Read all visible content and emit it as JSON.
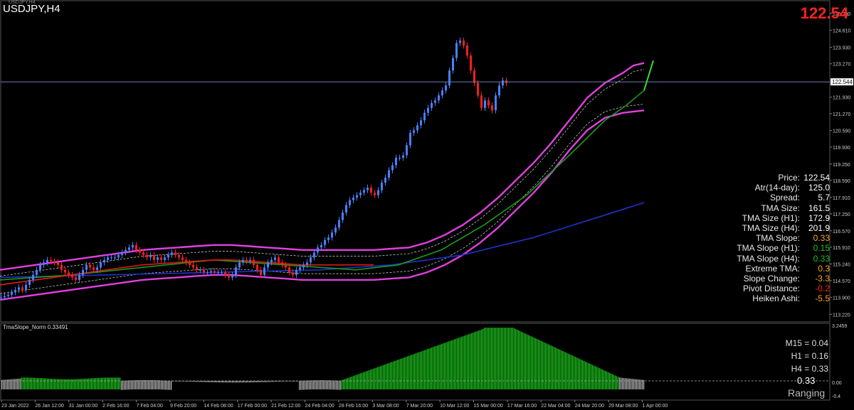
{
  "header": {
    "symbol_title": "USDJPY,H4",
    "tiny_label": "USDJPY,H4",
    "current_price": "122.54"
  },
  "chart_data": {
    "type": "line",
    "title": "USDJPY,H4",
    "price_axis_labels": [
      "125.290",
      "124.610",
      "123.930",
      "123.270",
      "122.544",
      "121.930",
      "121.270",
      "120.590",
      "119.930",
      "119.250",
      "118.590",
      "117.910",
      "117.250",
      "116.570",
      "115.910",
      "115.240",
      "114.570",
      "113.900",
      "113.220"
    ],
    "price_ticks": [
      125.29,
      124.61,
      123.93,
      123.27,
      122.544,
      121.93,
      121.27,
      120.59,
      119.93,
      119.25,
      118.59,
      117.91,
      117.25,
      116.57,
      115.91,
      115.24,
      114.57,
      113.9,
      113.22
    ],
    "current_price_line": 122.544,
    "ylim": [
      113.0,
      125.6
    ],
    "time_axis_labels": [
      "23 Jan 2022",
      "26 Jan 12:00",
      "31 Jan 00:00",
      "2 Feb 16:00",
      "7 Feb 04:00",
      "9 Feb 20:00",
      "14 Feb 08:00",
      "17 Feb 00:00",
      "21 Feb 12:00",
      "24 Feb 04:00",
      "28 Feb 16:00",
      "3 Mar 08:00",
      "7 Mar 20:00",
      "10 Mar 12:00",
      "15 Mar 00:00",
      "17 Mar 16:00",
      "22 Mar 04:00",
      "24 Mar 20:00",
      "29 Mar 08:00",
      "1 Apr 00:00"
    ],
    "price_path_x": [
      0,
      5,
      10,
      15,
      20,
      25,
      30,
      35,
      40,
      45,
      50,
      55,
      60,
      65,
      70,
      75,
      80,
      85,
      90,
      95,
      100,
      105,
      110,
      115,
      120,
      125,
      130,
      135,
      140,
      145,
      150,
      155,
      160,
      165,
      170,
      175,
      180,
      185,
      190,
      195,
      200,
      205,
      210,
      215,
      220,
      225,
      230,
      235,
      240,
      245,
      250,
      255,
      260,
      265,
      270,
      275,
      280,
      285,
      290,
      295,
      300,
      305,
      310,
      315,
      320,
      325,
      330,
      335,
      340,
      345,
      350,
      355,
      360,
      365,
      370,
      375,
      380,
      385,
      390,
      395,
      400,
      405,
      410,
      415,
      420,
      425,
      430,
      435,
      440,
      445,
      450,
      455,
      460,
      465,
      470,
      475,
      480,
      485,
      490,
      495,
      500,
      505,
      510,
      515,
      520,
      525,
      530,
      535,
      540,
      545,
      550,
      555,
      560,
      565,
      570,
      575,
      580,
      585,
      590,
      595,
      600,
      605,
      610,
      615,
      620,
      625,
      630,
      635,
      640,
      645,
      650,
      655,
      660,
      665,
      670,
      675,
      680,
      685,
      690,
      695,
      700,
      705,
      710,
      715,
      720,
      725,
      730,
      735,
      740,
      745,
      750,
      755,
      760,
      765,
      770,
      775,
      780,
      785,
      790,
      795,
      800,
      805,
      810,
      815,
      820,
      825,
      830,
      835,
      840,
      845,
      850,
      855,
      860,
      865,
      870,
      875,
      880,
      885,
      890,
      895,
      900
    ],
    "price_path": [
      113.9,
      113.95,
      114.0,
      114.1,
      114.2,
      114.3,
      114.2,
      114.4,
      114.6,
      114.8,
      115.0,
      115.2,
      115.3,
      115.4,
      115.35,
      115.3,
      115.2,
      115.0,
      114.9,
      114.8,
      114.7,
      114.6,
      114.8,
      115.0,
      115.2,
      115.1,
      115.0,
      115.1,
      115.3,
      115.4,
      115.5,
      115.5,
      115.5,
      115.6,
      115.7,
      115.8,
      115.9,
      116.0,
      115.8,
      115.7,
      115.6,
      115.5,
      115.6,
      115.4,
      115.5,
      115.4,
      115.5,
      115.6,
      115.7,
      115.6,
      115.5,
      115.4,
      115.3,
      115.2,
      115.1,
      115.0,
      115.0,
      114.9,
      114.9,
      114.95,
      114.9,
      114.9,
      114.9,
      114.8,
      114.7,
      114.8,
      115.1,
      115.3,
      115.4,
      115.35,
      115.4,
      115.2,
      115.0,
      114.8,
      115.1,
      115.3,
      115.4,
      115.5,
      115.3,
      115.2,
      115.1,
      114.9,
      114.8,
      115.0,
      115.1,
      115.2,
      115.3,
      115.5,
      115.7,
      115.9,
      116.0,
      116.2,
      116.3,
      116.5,
      116.7,
      117.0,
      117.3,
      117.6,
      117.8,
      117.9,
      118.0,
      118.1,
      118.2,
      118.3,
      118.1,
      118.0,
      118.2,
      118.5,
      118.7,
      119.0,
      119.2,
      119.5,
      119.5,
      119.6,
      120.0,
      120.5,
      120.6,
      120.8,
      121.0,
      121.3,
      121.5,
      121.7,
      121.8,
      122.0,
      122.2,
      122.4,
      123.0,
      123.5,
      124.1,
      124.2,
      124.0,
      123.6,
      123.0,
      122.5,
      122.0,
      121.5,
      121.8,
      121.6,
      121.4,
      122.0,
      122.4,
      122.6,
      122.5
    ],
    "upper_band_y": [
      115.0,
      115.1,
      115.2,
      115.3,
      115.4,
      115.5,
      115.6,
      115.7,
      115.8,
      115.85,
      115.9,
      115.95,
      116.0,
      116.0,
      115.95,
      115.9,
      115.85,
      115.8,
      115.8,
      115.8,
      115.8,
      115.8,
      115.85,
      115.9,
      116.1,
      116.4,
      116.8,
      117.3,
      117.9,
      118.6,
      119.3,
      120.1,
      121.0,
      121.9,
      122.5,
      122.9,
      123.2,
      123.3
    ],
    "lower_band_y": [
      113.8,
      113.9,
      114.0,
      114.1,
      114.2,
      114.3,
      114.4,
      114.5,
      114.6,
      114.65,
      114.7,
      114.75,
      114.8,
      114.8,
      114.75,
      114.7,
      114.65,
      114.6,
      114.6,
      114.6,
      114.6,
      114.6,
      114.65,
      114.7,
      114.9,
      115.2,
      115.6,
      116.1,
      116.7,
      117.4,
      118.1,
      118.9,
      119.8,
      120.6,
      121.1,
      121.3,
      121.35,
      121.4
    ],
    "band_x": [
      0,
      25,
      50,
      75,
      100,
      125,
      150,
      175,
      200,
      225,
      250,
      275,
      300,
      325,
      350,
      375,
      400,
      425,
      450,
      475,
      500,
      525,
      550,
      575,
      600,
      625,
      650,
      675,
      700,
      725,
      750,
      775,
      800,
      825,
      850,
      875,
      890,
      905
    ],
    "green_ma_x": [
      0,
      100,
      200,
      300,
      400,
      500,
      560,
      620,
      680,
      740,
      800,
      850,
      880,
      905
    ],
    "green_ma": [
      114.6,
      114.8,
      115.1,
      115.4,
      115.2,
      115.0,
      115.2,
      115.8,
      116.8,
      118.0,
      119.6,
      121.0,
      121.6,
      122.2
    ],
    "blue_ma_x": [
      0,
      150,
      300,
      450,
      550,
      650,
      750,
      850,
      905
    ],
    "blue_ma": [
      114.7,
      114.8,
      114.9,
      115.0,
      115.2,
      115.6,
      116.3,
      117.2,
      117.7
    ],
    "projection_green": [
      122.2,
      123.4
    ],
    "sub_window": {
      "name": "TmaSlope_Norm 0.33491",
      "axis_labels": [
        "3.2459",
        "0.00",
        "-0.4"
      ],
      "values_note_keys": [
        "M15",
        "H1",
        "H4"
      ]
    }
  },
  "info_panel": [
    {
      "k": "Price:",
      "v": "122.54",
      "color": "#ffffff"
    },
    {
      "k": "Atr(14-day):",
      "v": "125.0",
      "color": "#ffffff"
    },
    {
      "k": "Spread:",
      "v": "5.7",
      "color": "#ffffff"
    },
    {
      "k": "TMA Size:",
      "v": "161.5",
      "color": "#ffffff"
    },
    {
      "k": "TMA Size (H1):",
      "v": "172.9",
      "color": "#ffffff"
    },
    {
      "k": "TMA Size (H4):",
      "v": "201.9",
      "color": "#ffffff"
    },
    {
      "k": "TMA Slope:",
      "v": "0.33",
      "color": "#ffa020"
    },
    {
      "k": "TMA Slope (H1):",
      "v": "0.15",
      "color": "#1ec01e"
    },
    {
      "k": "TMA Slope (H4):",
      "v": "0.33",
      "color": "#1ec01e"
    },
    {
      "k": "Extreme TMA:",
      "v": "0.3",
      "color": "#ffa020"
    },
    {
      "k": "Slope Change:",
      "v": "-3.3",
      "color": "#ffa020"
    },
    {
      "k": "Pivot Distance:",
      "v": "-0.2",
      "color": "#ff2020"
    },
    {
      "k": "Heiken Ashi:",
      "v": "-5.5",
      "color": "#ffa020"
    }
  ],
  "sub_panel": {
    "m15": "M15 = 0.04",
    "h1": "H1 = 0.16",
    "h4": "H4 = 0.33",
    "value": "0.33",
    "status": "Ranging",
    "name": "TmaSlope_Norm 0.33491",
    "axis_top": "3.2459",
    "axis_zero": "0.00",
    "axis_bottom": "-0.4"
  },
  "colors": {
    "band": "#e040e0",
    "up_candle": "#4a7fff",
    "down_candle": "#ff1e1e",
    "green_ma": "#1a9a1a",
    "blue_ma": "#1c34c8",
    "hist_green": "#1fd41f",
    "hist_gray": "#b8b8b8",
    "price_line": "#6a7fb0"
  }
}
